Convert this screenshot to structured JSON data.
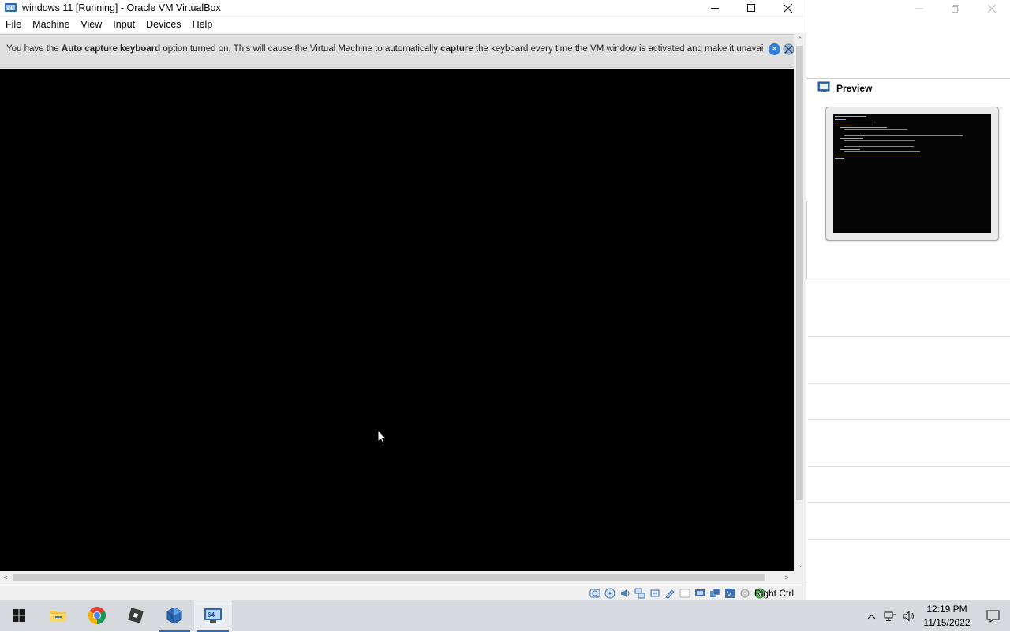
{
  "vm_window": {
    "title": "windows 11 [Running] - Oracle VM VirtualBox",
    "menu": [
      "File",
      "Machine",
      "View",
      "Input",
      "Devices",
      "Help"
    ],
    "notice": {
      "part1": "You have the ",
      "bold1": "Auto capture keyboard",
      "part2": " option turned on. This will cause the Virtual Machine to automatically ",
      "bold2": "capture",
      "part3": " the keyboard every time the VM window is activated and make it unavailable to"
    },
    "status": {
      "host_key": "Right Ctrl",
      "icons": [
        "hard-disk-icon",
        "optical-drive-icon",
        "audio-icon",
        "network-icon",
        "usb-icon",
        "shared-folders-icon",
        "display-icon",
        "video-capture-icon",
        "virtualization-icon",
        "mouse-integration-icon",
        "keyboard-capture-icon"
      ]
    }
  },
  "manager": {
    "preview_title": "Preview"
  },
  "taskbar": {
    "apps": [
      "start-button",
      "file-explorer",
      "chrome",
      "roblox",
      "virtualbox-manager",
      "virtualbox-vm"
    ],
    "clock": {
      "time": "12:19 PM",
      "date": "11/15/2022"
    }
  },
  "colors": {
    "vm_screen": "#000000",
    "taskbar": "#d6dadf",
    "accent": "#2e6fc5"
  }
}
